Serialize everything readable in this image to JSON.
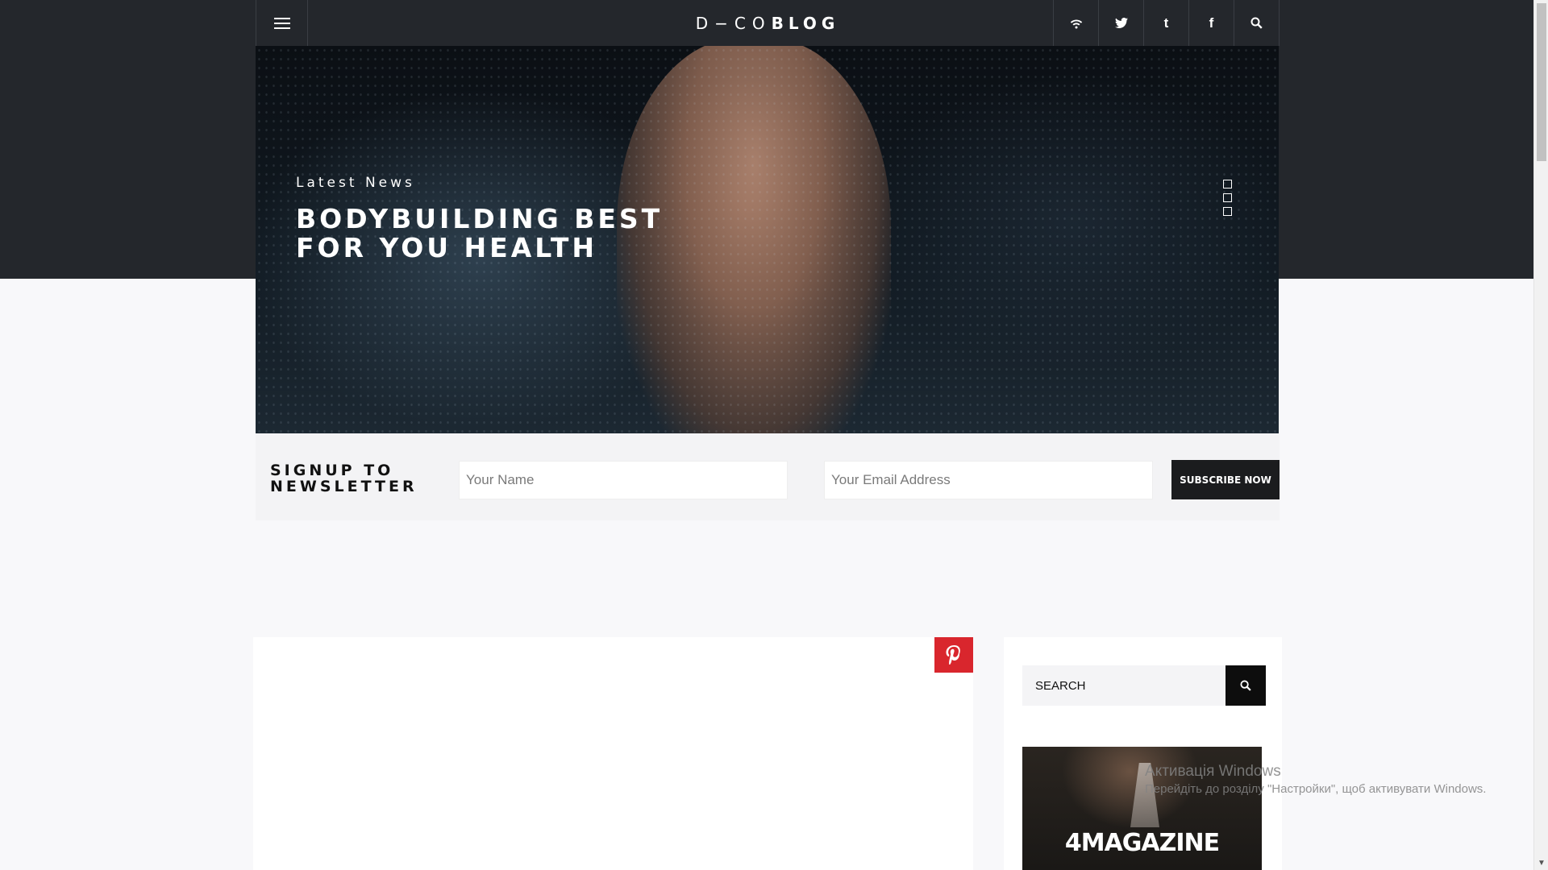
{
  "header": {
    "logo_prefix": "D−CO",
    "logo_suffix": "BLOG",
    "icons": [
      "menu-icon",
      "rss-icon",
      "twitter-icon",
      "tumblr-icon",
      "facebook-icon",
      "search-icon"
    ],
    "tumblr_glyph": "t",
    "facebook_glyph": "f"
  },
  "hero": {
    "eyebrow": "Latest News",
    "title_line1": "BODYBUILDING BEST",
    "title_line2": "FOR YOU HEALTH",
    "slide_count": 3
  },
  "newsletter": {
    "title_line1": "SIGNUP TO",
    "title_line2": "NEWSLETTER",
    "name_placeholder": "Your Name",
    "email_placeholder": "Your Email Address",
    "button_label": "SUBSCRIBE NOW"
  },
  "sidebar": {
    "search_placeholder": "SEARCH",
    "ad_text": "4MAGAZINE"
  },
  "watermark": {
    "title": "Активація Windows",
    "subtitle": "Перейдіть до розділу \"Настройки\", щоб активувати Windows."
  },
  "colors": {
    "dark_band": "#24272c",
    "pinterest": "#d9262d",
    "button_dark": "#1b1c1e"
  }
}
